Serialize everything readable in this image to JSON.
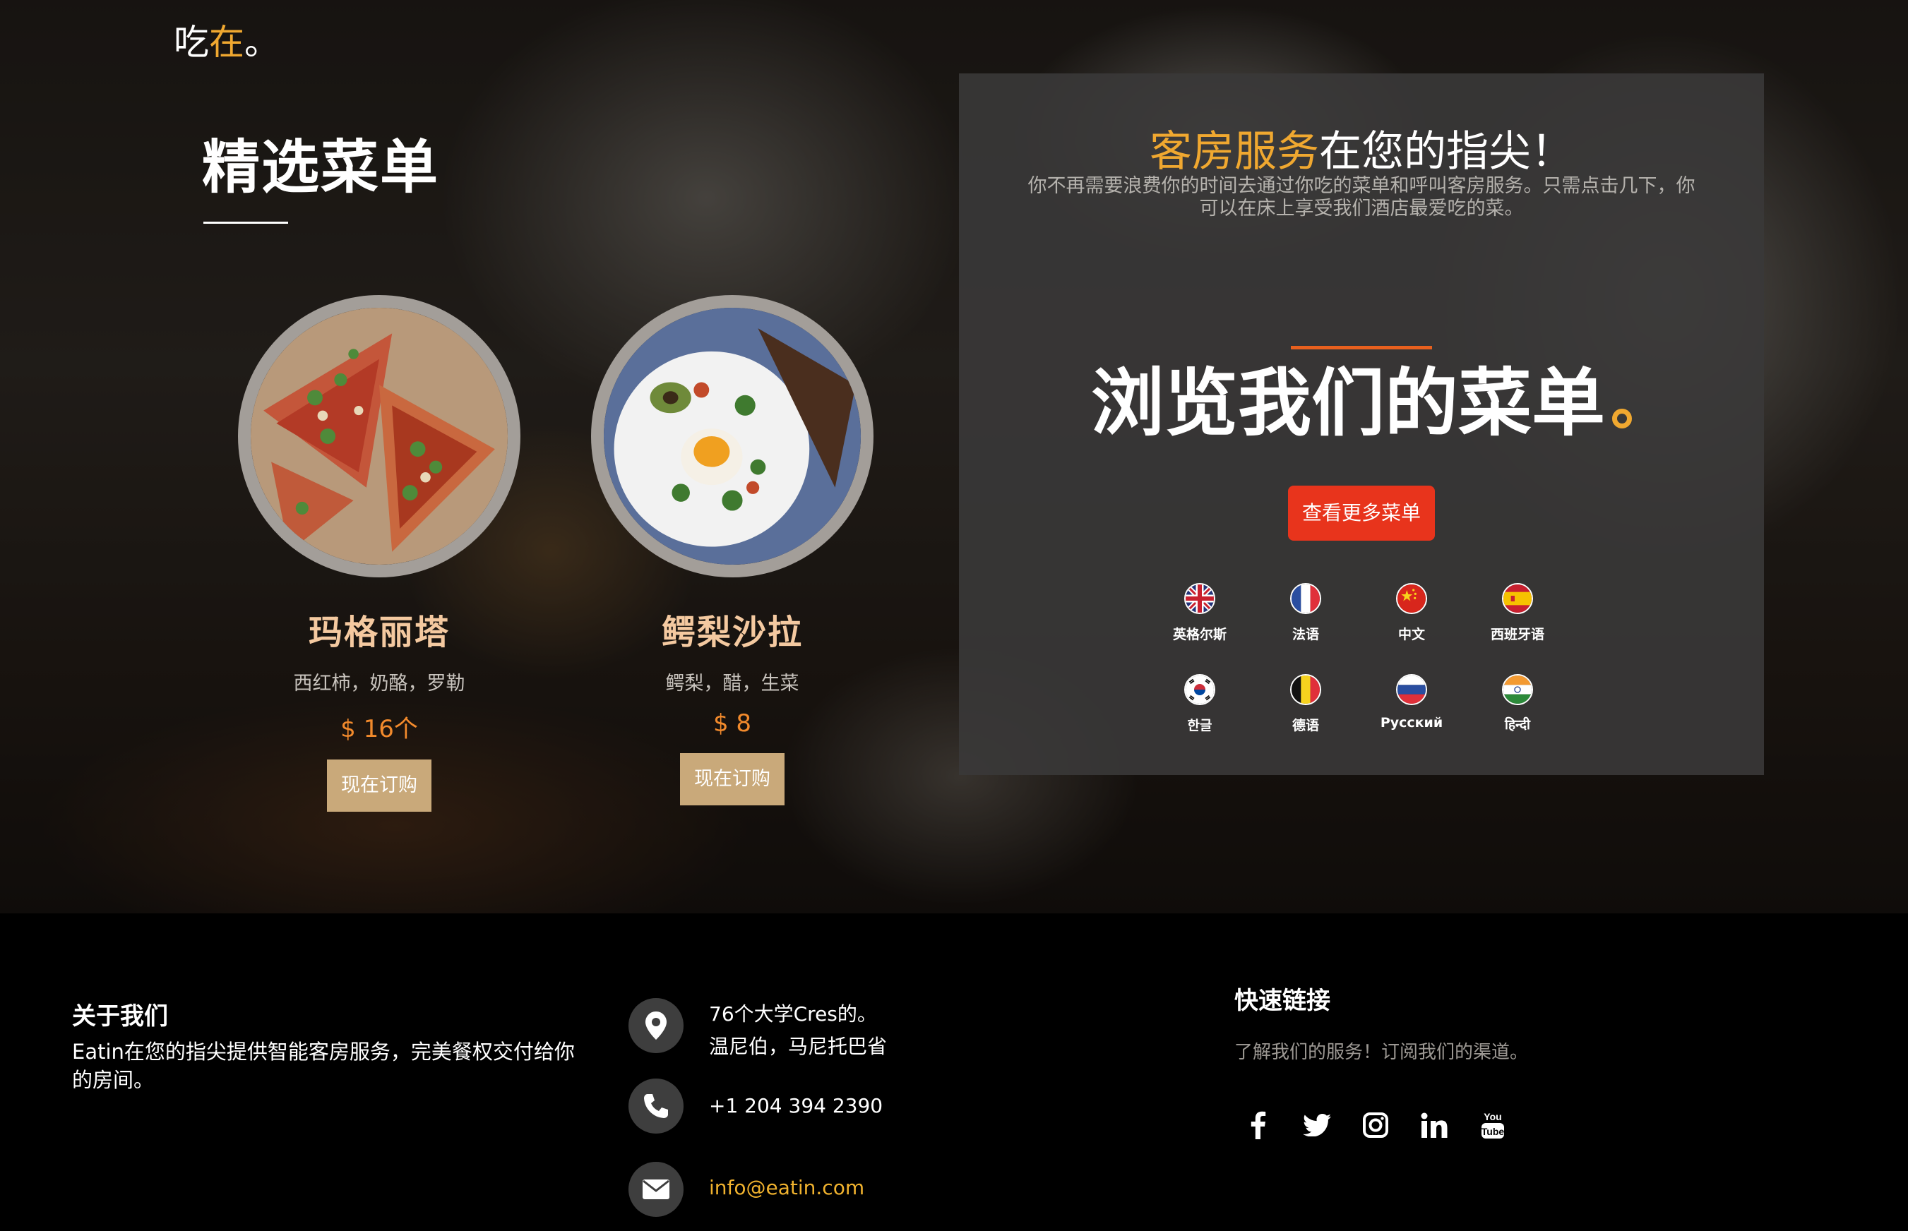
{
  "hero": {
    "tagline_prefix": "吃",
    "tagline_highlight": "在",
    "tagline_suffix": "。",
    "featured_title": "精选菜单"
  },
  "menu_items": [
    {
      "name": "玛格丽塔",
      "description": "西红柿，奶酪，罗勒",
      "price": "$ 16个",
      "order_label": "现在订购",
      "image": "pizza"
    },
    {
      "name": "鳄梨沙拉",
      "description": "鳄梨，醋，生菜",
      "price": "$ 8",
      "order_label": "现在订购",
      "image": "avocado-salad"
    }
  ],
  "room_service": {
    "title_highlight": "客房服务",
    "title_rest": "在您的指尖！",
    "subtitle": "你不再需要浪费你的时间去通过你吃的菜单和呼叫客房服务。只需点击几下，你可以在床上享受我们酒店最爱吃的菜。",
    "browse_title": "浏览我们的菜单",
    "more_button": "查看更多菜单",
    "languages": [
      {
        "label": "英格尔斯",
        "flag": "uk-flag-icon"
      },
      {
        "label": "法语",
        "flag": "france-flag-icon"
      },
      {
        "label": "中文",
        "flag": "china-flag-icon"
      },
      {
        "label": "西班牙语",
        "flag": "spain-flag-icon"
      },
      {
        "label": "한글",
        "flag": "korea-flag-icon"
      },
      {
        "label": "德语",
        "flag": "belgium-flag-icon"
      },
      {
        "label": "Русский",
        "flag": "russia-flag-icon"
      },
      {
        "label": "हिन्दी",
        "flag": "india-flag-icon"
      }
    ]
  },
  "footer": {
    "about_heading": "关于我们",
    "about_text": "Eatin在您的指尖提供智能客房服务，完美餐权交付给你的房间。",
    "address_line1": "76个大学Cres的。",
    "address_line2": "温尼伯，马尼托巴省",
    "phone": "+1 204 394 2390",
    "email": "info@eatin.com",
    "quick_heading": "快速链接",
    "quick_text": "了解我们的服务！订阅我们的渠道。",
    "socials": [
      "facebook-icon",
      "twitter-icon",
      "instagram-icon",
      "linkedin-icon",
      "youtube-icon"
    ]
  },
  "colors": {
    "accent_gold": "#f0a830",
    "price_orange": "#f28a2c",
    "order_button": "#c9a97a",
    "more_button": "#e8341c",
    "dish_name": "#f4c9a0",
    "email_link": "#f0b22e"
  }
}
